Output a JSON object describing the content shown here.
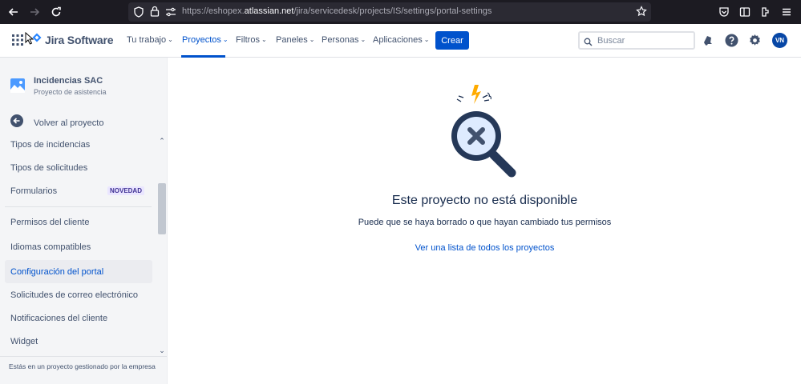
{
  "browser": {
    "url_prefix": "https://eshopex.",
    "url_domain": "atlassian.net",
    "url_path": "/jira/servicedesk/projects/IS/settings/portal-settings"
  },
  "topnav": {
    "product": "Jira Software",
    "menu": [
      {
        "label": "Tu trabajo"
      },
      {
        "label": "Proyectos"
      },
      {
        "label": "Filtros"
      },
      {
        "label": "Paneles"
      },
      {
        "label": "Personas"
      },
      {
        "label": "Aplicaciones"
      }
    ],
    "create_label": "Crear",
    "search_placeholder": "Buscar",
    "avatar_initials": "VN"
  },
  "sidebar": {
    "project_name": "Incidencias SAC",
    "project_type": "Proyecto de asistencia",
    "back_label": "Volver al proyecto",
    "items": [
      {
        "label": "Tipos de incidencias"
      },
      {
        "label": "Tipos de solicitudes"
      },
      {
        "label": "Formularios",
        "badge": "NOVEDAD"
      },
      {
        "label": "Permisos del cliente"
      },
      {
        "label": "Idiomas compatibles"
      },
      {
        "label": "Configuración del portal"
      },
      {
        "label": "Solicitudes de correo electrónico"
      },
      {
        "label": "Notificaciones del cliente"
      },
      {
        "label": "Widget"
      }
    ],
    "footer": "Estás en un proyecto gestionado por la empresa"
  },
  "main": {
    "title": "Este proyecto no está disponible",
    "description": "Puede que se haya borrado o que hayan cambiado tus permisos",
    "link": "Ver una lista de todos los proyectos"
  },
  "colors": {
    "brand": "#0052cc",
    "sidebar_bg": "#f4f5f7",
    "browser_bg": "#1c1b22"
  }
}
